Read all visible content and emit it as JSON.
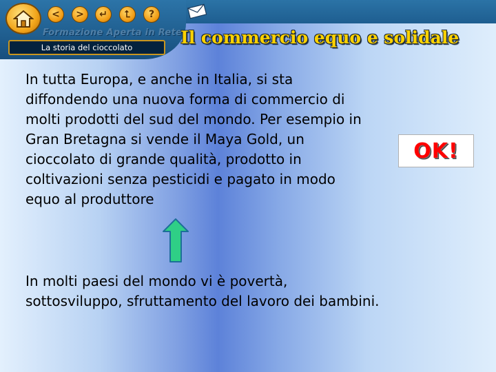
{
  "header": {
    "brand_text": "Formazione Aperta in Rete",
    "course_label": "La storia del cioccolato",
    "title": "Il commercio equo e solidale"
  },
  "nav": {
    "buttons": [
      {
        "icon": "home-icon"
      },
      {
        "icon": "back-icon",
        "glyph": "<"
      },
      {
        "icon": "forward-icon",
        "glyph": ">"
      },
      {
        "icon": "return-icon",
        "glyph": "↵"
      },
      {
        "icon": "index-icon",
        "glyph": "⮤"
      },
      {
        "icon": "help-icon",
        "glyph": "?"
      },
      {
        "icon": "mail-icon"
      }
    ]
  },
  "content": {
    "paragraph1": "In tutta Europa, e anche in Italia, si sta diffondendo una nuova forma di commercio di molti prodotti del sud del mondo. Per esempio in Gran Bretagna si vende il Maya Gold, un cioccolato di grande qualità, prodotto in coltivazioni senza pesticidi e pagato in modo equo al produttore",
    "paragraph2": "In molti paesi del mondo vi è povertà, sottosviluppo, sfruttamento del lavoro dei bambini.",
    "ok_label": "OK!"
  },
  "colors": {
    "title": "#ffd200",
    "ok_text": "#ff0000",
    "arrow": "#2fcf86",
    "nav_orange": "#f09a12",
    "header_blue": "#1e5e90"
  }
}
